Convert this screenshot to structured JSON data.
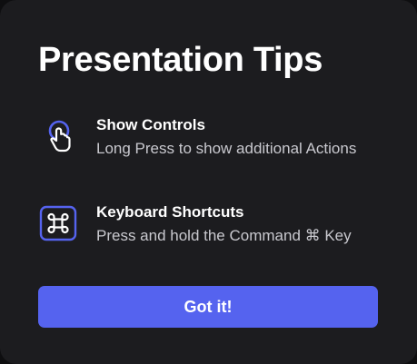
{
  "dialog": {
    "title": "Presentation Tips",
    "tips": [
      {
        "icon": "hand-press-icon",
        "title": "Show Controls",
        "description": "Long Press to show additional Actions"
      },
      {
        "icon": "command-key-icon",
        "title": "Keyboard Shortcuts",
        "description": "Press and hold the Command ⌘ Key"
      }
    ],
    "confirm_label": "Got it!"
  },
  "colors": {
    "background": "#1c1c1f",
    "accent": "#5563ef",
    "text_primary": "#ffffff",
    "text_secondary": "#c9c9cf"
  }
}
